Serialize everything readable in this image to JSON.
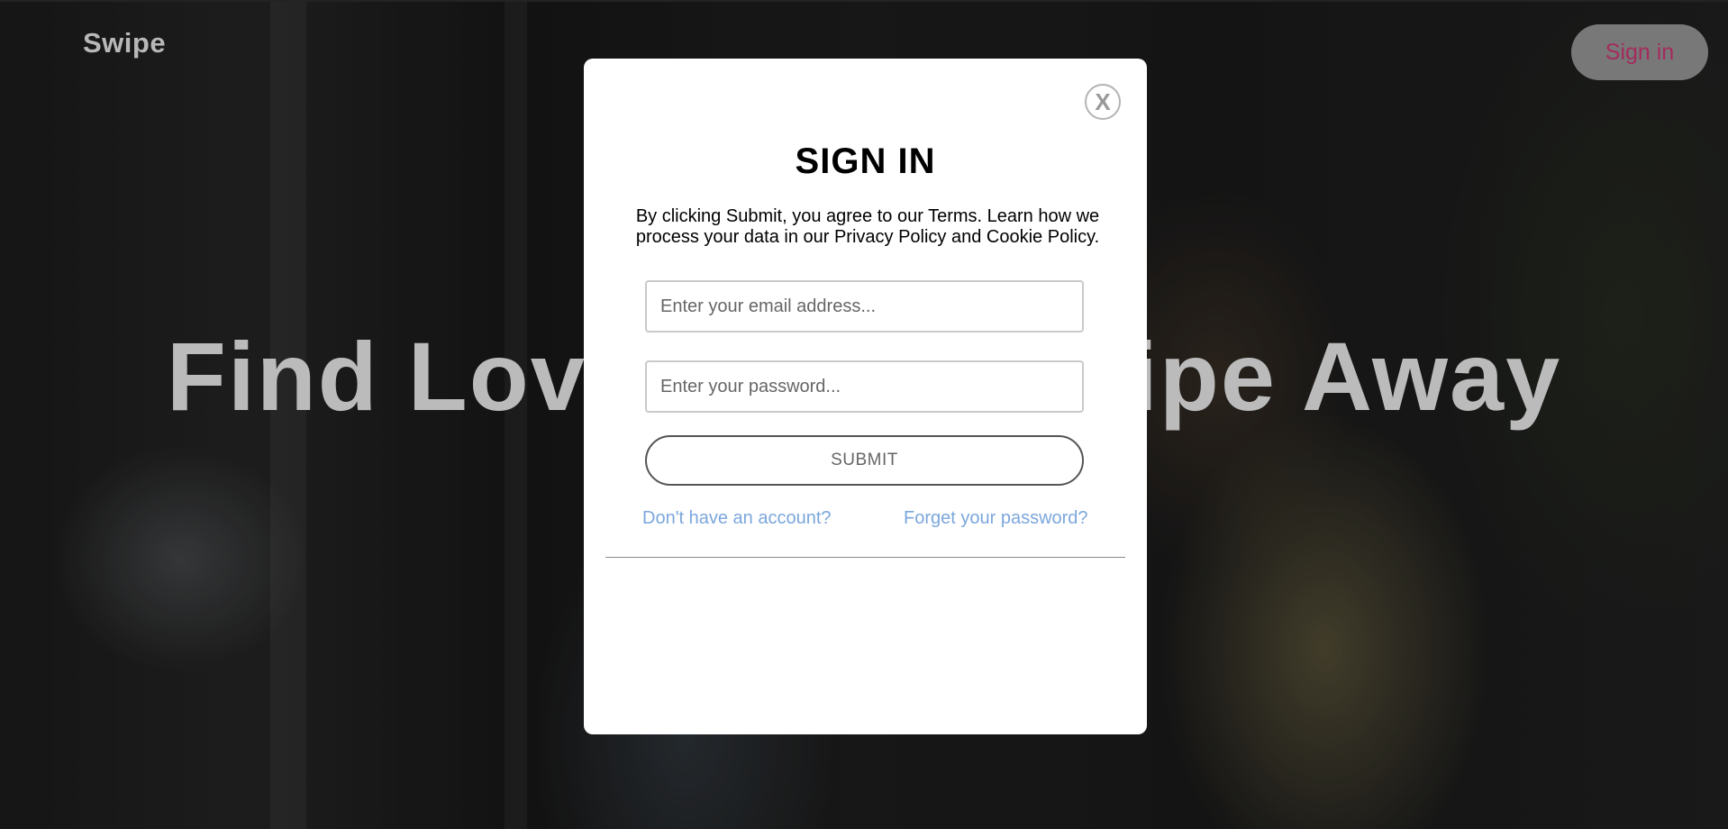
{
  "header": {
    "brand": "Swipe",
    "signin_label": "Sign in"
  },
  "hero": {
    "title": "Find Love with a Swipe Away"
  },
  "modal": {
    "close_label": "X",
    "title": "SIGN IN",
    "notice": "By clicking Submit, you agree to our Terms. Learn how we process your data in our Privacy Policy and Cookie Policy.",
    "email_placeholder": "Enter your email address...",
    "password_placeholder": "Enter your password...",
    "submit_label": "SUBMIT",
    "signup_link": "Don't have an account?",
    "forgot_link": "Forget your password?"
  },
  "colors": {
    "brand_pink": "#c2336e",
    "link_blue": "#7ba7dc"
  }
}
